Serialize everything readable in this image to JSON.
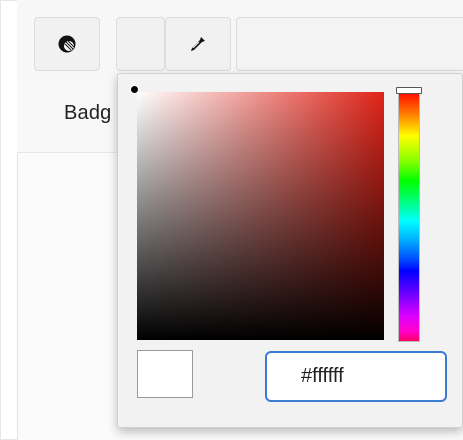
{
  "toolbar": {
    "buttons": [
      {
        "icon": "fill-color-icon"
      },
      {
        "icon": "blank"
      },
      {
        "icon": "eyedropper-icon"
      }
    ]
  },
  "row": {
    "label": "Badg"
  },
  "color_picker": {
    "base_hue_color": "#e02318",
    "selected_color": "#ffffff",
    "hex_value": "#ffffff"
  }
}
